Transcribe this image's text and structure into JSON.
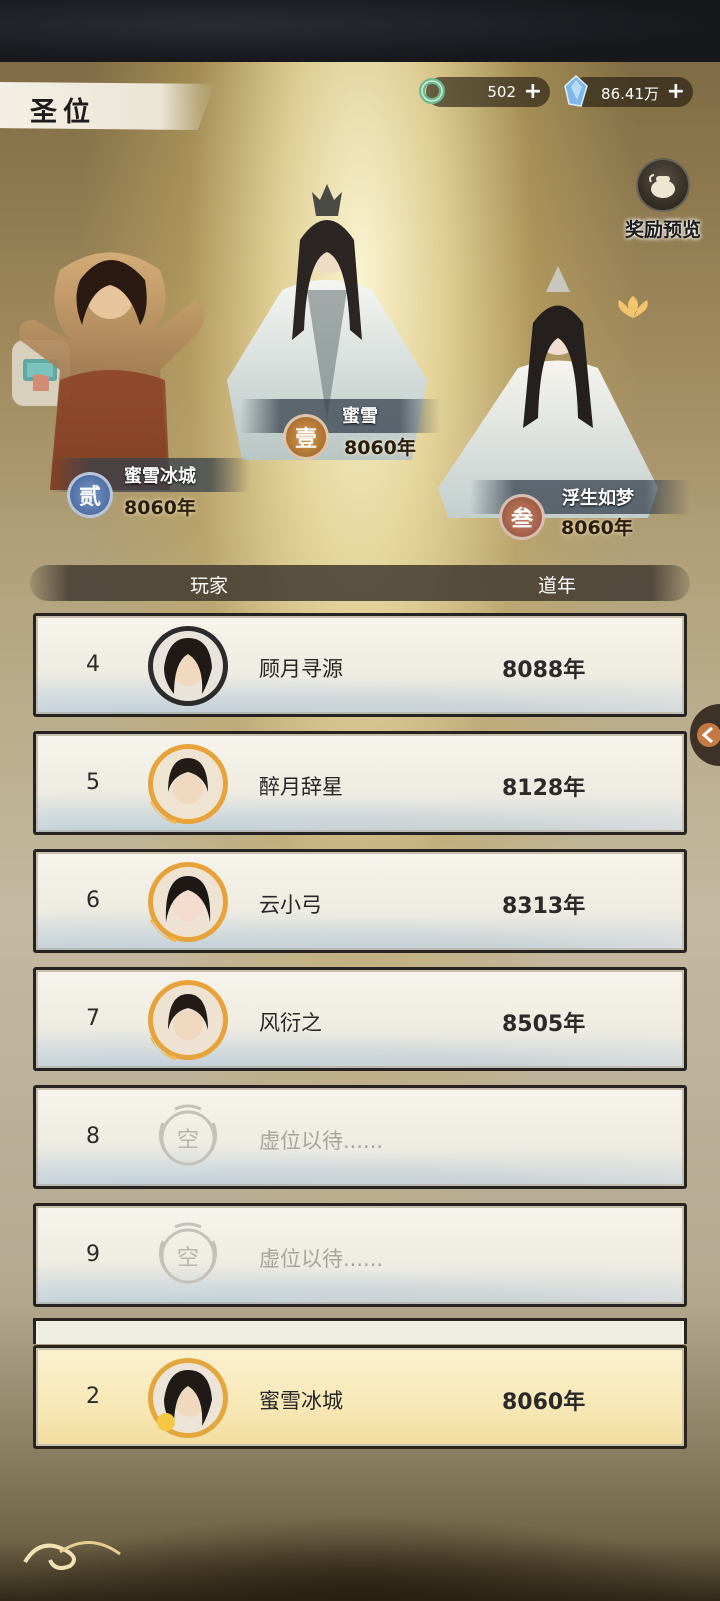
{
  "title": "圣位",
  "currencies": [
    {
      "icon": "jade-ring-icon",
      "value": "502",
      "plus": "+"
    },
    {
      "icon": "blue-crystal-icon",
      "value": "86.41万",
      "plus": "+"
    }
  ],
  "reward_preview": {
    "label": "奖励预览",
    "icon": "treasure-pot-icon"
  },
  "podium": {
    "first": {
      "badge": "壹",
      "name": "蜜雪",
      "years": "8060年"
    },
    "second": {
      "badge": "贰",
      "name": "蜜雪冰城",
      "years": "8060年"
    },
    "third": {
      "badge": "叁",
      "name": "浮生如梦",
      "years": "8060年"
    }
  },
  "table_header": {
    "player": "玩家",
    "years": "道年"
  },
  "rows": [
    {
      "rank": "4",
      "name": "顾月寻源",
      "years": "8088年"
    },
    {
      "rank": "5",
      "name": "醉月辞星",
      "years": "8128年"
    },
    {
      "rank": "6",
      "name": "云小弓",
      "years": "8313年"
    },
    {
      "rank": "7",
      "name": "风衍之",
      "years": "8505年"
    },
    {
      "rank": "8",
      "name": "虚位以待......",
      "years": "",
      "empty_avatar": "空"
    },
    {
      "rank": "9",
      "name": "虚位以待......",
      "years": "",
      "empty_avatar": "空"
    }
  ],
  "my_row": {
    "rank": "2",
    "name": "蜜雪冰城",
    "years": "8060年"
  },
  "colors": {
    "gold_ring": "#e8a23a",
    "badge_gold": "#c9873e",
    "badge_blue": "#5d7fb8",
    "badge_bronze": "#b76a4a"
  }
}
